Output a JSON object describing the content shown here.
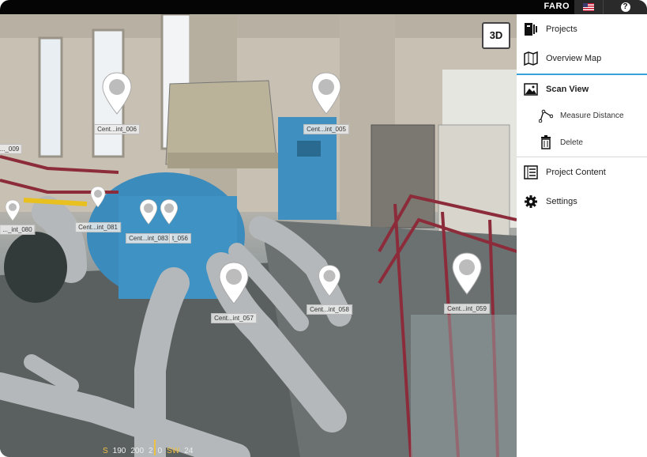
{
  "topbar": {
    "logo": "FARO",
    "help": "?"
  },
  "viewport": {
    "mode_button": "3D",
    "pins": [
      {
        "label": "Cent...int_006"
      },
      {
        "label": "Cent...int_005"
      },
      {
        "label": "..._009"
      },
      {
        "label": "Cent...int_081"
      },
      {
        "label": "Cent...int_083"
      },
      {
        "label": "t_056"
      },
      {
        "label": "..._int_080"
      },
      {
        "label": "Cent...int_057"
      },
      {
        "label": "Cent...int_058"
      },
      {
        "label": "Cent...int_059"
      }
    ],
    "compass": {
      "readouts": [
        "S",
        "190",
        "200",
        "2",
        "0",
        "SW",
        "24"
      ]
    }
  },
  "sidebar": {
    "projects": "Projects",
    "overview_map": "Overview Map",
    "scan_view": "Scan View",
    "measure_distance": "Measure Distance",
    "delete": "Delete",
    "project_content": "Project Content",
    "settings": "Settings"
  },
  "colors": {
    "accent": "#3aa0d8",
    "topbar": "#050505"
  }
}
